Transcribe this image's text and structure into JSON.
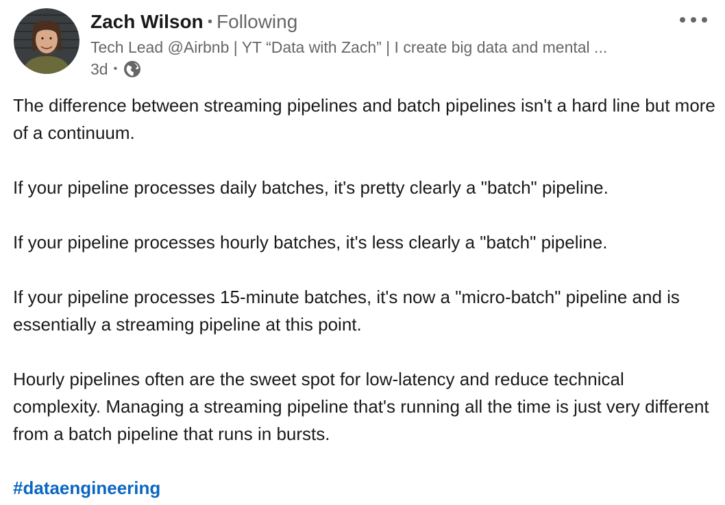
{
  "author": {
    "name": "Zach Wilson",
    "follow_status": "Following",
    "headline": "Tech Lead @Airbnb | YT “Data with Zach” | I create big data and mental ...",
    "time_ago": "3d",
    "visibility_icon": "globe-icon"
  },
  "menu": {
    "icon": "more-horizontal-icon"
  },
  "post": {
    "paragraphs": [
      "The difference between streaming pipelines and batch pipelines isn't a hard line but more of a continuum.",
      "If your pipeline processes daily batches, it's pretty clearly a \"batch\" pipeline.",
      "If your pipeline processes hourly batches, it's less clearly a \"batch\" pipeline.",
      "If your pipeline processes 15-minute batches, it's now a \"micro-batch\" pipeline and is essentially a streaming pipeline at this point.",
      "Hourly pipelines often are the sweet spot for low-latency and reduce technical complexity. Managing a streaming pipeline that's running all the time is just very different from a batch pipeline that runs in bursts."
    ],
    "hashtag": "#dataengineering"
  },
  "colors": {
    "text_primary": "#191919",
    "text_secondary": "#666666",
    "link": "#0a66c2"
  }
}
